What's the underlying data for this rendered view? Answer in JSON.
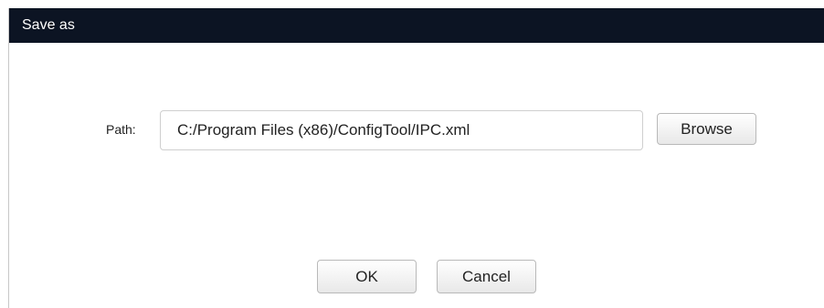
{
  "dialog": {
    "title": "Save as"
  },
  "path": {
    "label": "Path:",
    "value": "C:/Program Files (x86)/ConfigTool/IPC.xml"
  },
  "buttons": {
    "browse": "Browse",
    "ok": "OK",
    "cancel": "Cancel"
  },
  "colors": {
    "titlebar": "#0c1423",
    "title_text": "#ffffff"
  }
}
